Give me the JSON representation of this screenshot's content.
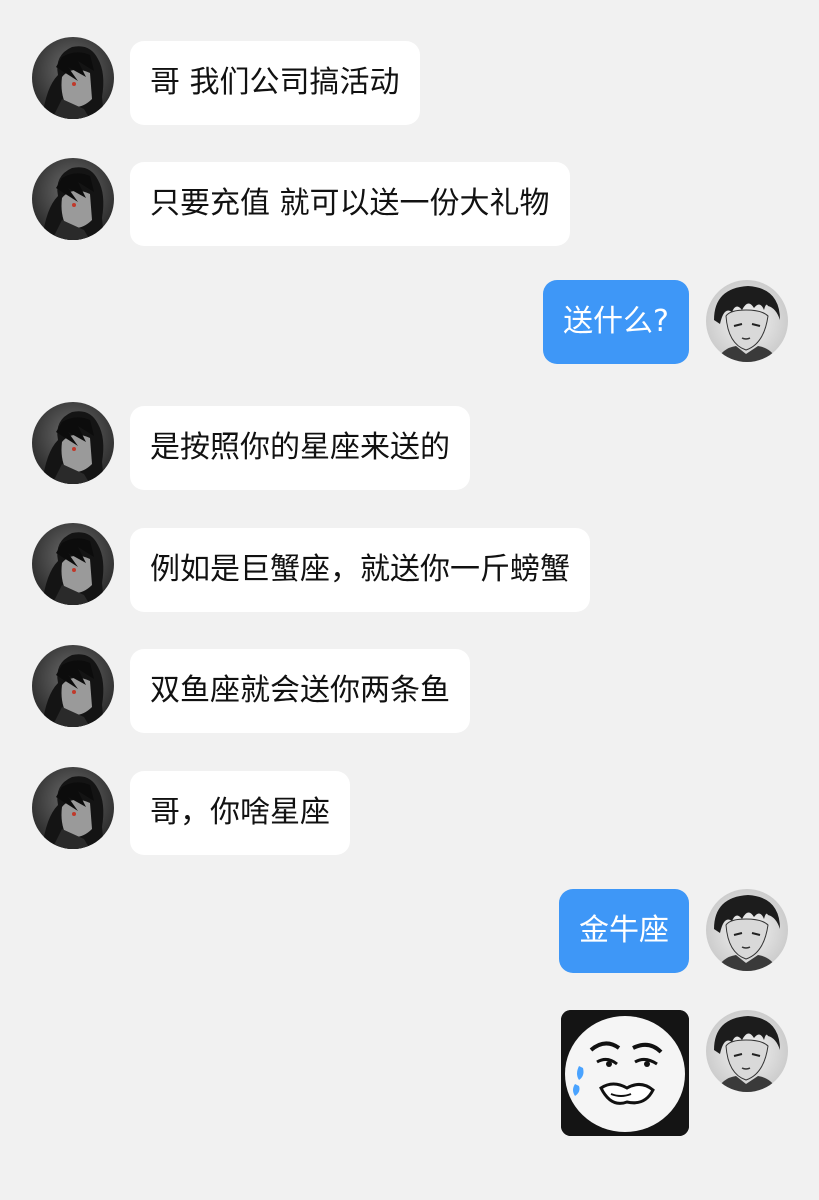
{
  "messages": [
    {
      "side": "in",
      "text": "哥 我们公司搞活动"
    },
    {
      "side": "in",
      "text": "只要充值 就可以送一份大礼物"
    },
    {
      "side": "out",
      "text": "送什么?"
    },
    {
      "side": "in",
      "text": "是按照你的星座来送的"
    },
    {
      "side": "in",
      "text": "例如是巨蟹座，就送你一斤螃蟹"
    },
    {
      "side": "in",
      "text": "双鱼座就会送你两条鱼"
    },
    {
      "side": "in",
      "text": "哥，你啥星座"
    },
    {
      "side": "out",
      "text": "金牛座"
    },
    {
      "side": "out",
      "type": "sticker",
      "icon": "meme-face-sticker"
    }
  ],
  "colors": {
    "background": "#f1f1f1",
    "incoming_bubble": "#ffffff",
    "outgoing_bubble": "#3e97f7",
    "incoming_text": "#111111",
    "outgoing_text": "#ffffff"
  },
  "icons": {
    "contact_avatar": "anime-contact-avatar-icon",
    "self_avatar": "anime-self-avatar-icon"
  }
}
